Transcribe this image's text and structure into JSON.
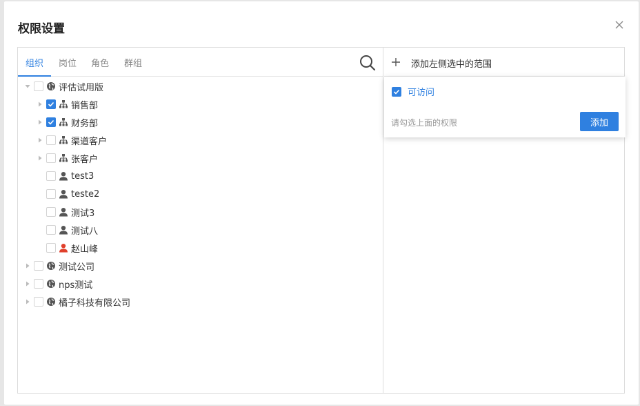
{
  "dialog": {
    "title": "权限设置",
    "close_icon": "close-icon"
  },
  "tabs": [
    {
      "label": "组织",
      "active": true
    },
    {
      "label": "岗位",
      "active": false
    },
    {
      "label": "角色",
      "active": false
    },
    {
      "label": "群组",
      "active": false
    }
  ],
  "tree": [
    {
      "label": "评估试用版",
      "icon": "globe-icon",
      "level": 0,
      "caret": "expanded",
      "checked": false
    },
    {
      "label": "销售部",
      "icon": "org-chart-icon",
      "level": 1,
      "caret": "collapsed",
      "checked": true
    },
    {
      "label": "财务部",
      "icon": "org-chart-icon",
      "level": 1,
      "caret": "collapsed",
      "checked": true
    },
    {
      "label": "渠道客户",
      "icon": "org-chart-icon",
      "level": 1,
      "caret": "collapsed",
      "checked": false
    },
    {
      "label": "张客户",
      "icon": "org-chart-icon",
      "level": 1,
      "caret": "collapsed",
      "checked": false
    },
    {
      "label": "test3",
      "icon": "user-icon",
      "level": 1,
      "caret": "none",
      "checked": false
    },
    {
      "label": "teste2",
      "icon": "user-icon",
      "level": 1,
      "caret": "none",
      "checked": false
    },
    {
      "label": "测试3",
      "icon": "user-icon",
      "level": 1,
      "caret": "none",
      "checked": false
    },
    {
      "label": "测试八",
      "icon": "user-icon",
      "level": 1,
      "caret": "none",
      "checked": false
    },
    {
      "label": "赵山峰",
      "icon": "user-icon-red",
      "level": 1,
      "caret": "none",
      "checked": false
    },
    {
      "label": "测试公司",
      "icon": "globe-icon",
      "level": 0,
      "caret": "collapsed",
      "checked": false
    },
    {
      "label": "nps测试",
      "icon": "globe-icon",
      "level": 0,
      "caret": "collapsed",
      "checked": false
    },
    {
      "label": "橘子科技有限公司",
      "icon": "globe-icon",
      "level": 0,
      "caret": "collapsed",
      "checked": false
    }
  ],
  "right_panel": {
    "title": "添加左侧选中的范围",
    "permission_label": "可访问",
    "permission_checked": true,
    "hint": "请勾选上面的权限",
    "add_label": "添加"
  },
  "colors": {
    "accent": "#2f80e0",
    "user_red": "#e0402c",
    "icon_gray": "#666666"
  }
}
